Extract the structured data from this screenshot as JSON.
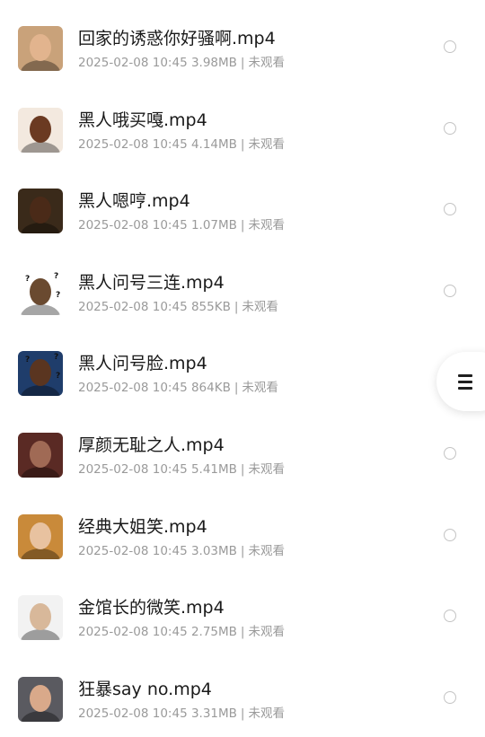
{
  "files": [
    {
      "title": "回家的诱惑你好骚啊.mp4",
      "date": "2025-02-08 10:45",
      "size": "3.98MB",
      "status": "未观看",
      "thumb": {
        "bg": "#c9a27a",
        "face": "#e2b48e",
        "icon": "man-face-thumbnail-icon"
      }
    },
    {
      "title": "黑人哦买嘎.mp4",
      "date": "2025-02-08 10:45",
      "size": "4.14MB",
      "status": "未观看",
      "thumb": {
        "bg": "#f3e9df",
        "face": "#6b3a22",
        "icon": "man-face-thumbnail-icon"
      }
    },
    {
      "title": "黑人嗯哼.mp4",
      "date": "2025-02-08 10:45",
      "size": "1.07MB",
      "status": "未观看",
      "thumb": {
        "bg": "#3a2a1a",
        "face": "#4a2a18",
        "icon": "man-face-thumbnail-icon"
      }
    },
    {
      "title": "黑人问号三连.mp4",
      "date": "2025-02-08 10:45",
      "size": "855KB",
      "status": "未观看",
      "thumb": {
        "bg": "#ffffff",
        "face": "#6a4a30",
        "icon": "question-face-thumbnail-icon"
      }
    },
    {
      "title": "黑人问号脸.mp4",
      "date": "2025-02-08 10:45",
      "size": "864KB",
      "status": "未观看",
      "thumb": {
        "bg": "#1f3d6b",
        "face": "#5a3520",
        "icon": "question-face-thumbnail-icon"
      }
    },
    {
      "title": "厚颜无耻之人.mp4",
      "date": "2025-02-08 10:45",
      "size": "5.41MB",
      "status": "未观看",
      "thumb": {
        "bg": "#5a2a24",
        "face": "#a06a55",
        "icon": "man-face-thumbnail-icon"
      }
    },
    {
      "title": "经典大姐笑.mp4",
      "date": "2025-02-08 10:45",
      "size": "3.03MB",
      "status": "未观看",
      "thumb": {
        "bg": "#c98a3a",
        "face": "#e8c2a0",
        "icon": "woman-face-thumbnail-icon"
      }
    },
    {
      "title": "金馆长的微笑.mp4",
      "date": "2025-02-08 10:45",
      "size": "2.75MB",
      "status": "未观看",
      "thumb": {
        "bg": "#f2f2f2",
        "face": "#d8b89a",
        "icon": "man-face-thumbnail-icon"
      }
    },
    {
      "title": "狂暴say no.mp4",
      "date": "2025-02-08 10:45",
      "size": "3.31MB",
      "status": "未观看",
      "thumb": {
        "bg": "#5a5a60",
        "face": "#d9a98a",
        "icon": "man-face-thumbnail-icon"
      }
    }
  ],
  "menu_button": {
    "icon": "menu-icon"
  }
}
